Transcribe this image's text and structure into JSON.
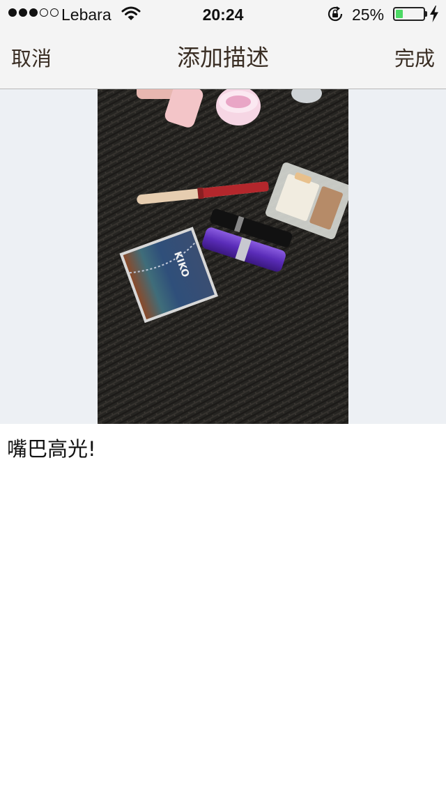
{
  "status_bar": {
    "carrier": "Lebara",
    "time": "20:24",
    "battery_percent": "25%",
    "battery_level": 0.25,
    "signal_bars_filled": 3,
    "signal_bars_total": 5,
    "icons": [
      "signal-dots-icon",
      "wifi-icon",
      "rotation-lock-icon",
      "battery-icon",
      "charging-icon"
    ]
  },
  "nav": {
    "cancel_label": "取消",
    "title": "添加描述",
    "done_label": "完成"
  },
  "photo": {
    "brand_text": "KIKO"
  },
  "description": {
    "text": "嘴巴高光!"
  },
  "colors": {
    "bar_background": "#f4f4f4",
    "nav_text": "#3a2e24",
    "battery_fill": "#4cd964",
    "photo_backdrop": "#edf0f4"
  }
}
